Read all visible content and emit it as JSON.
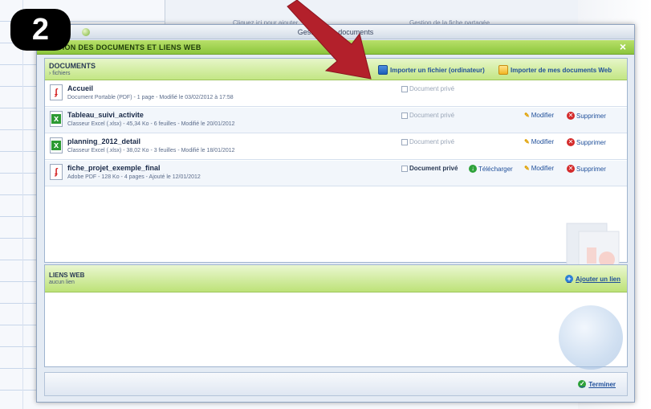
{
  "step_badge": "2",
  "background": {
    "behind_text_left": "Cliquez ici pour ajouter",
    "behind_text_right": "Gestion de la fiche partagée"
  },
  "window": {
    "title": "Gestion des documents",
    "header": "GESTION DES DOCUMENTS ET LIENS WEB",
    "close_label": "×"
  },
  "documents": {
    "title": "DOCUMENTS",
    "subtitle": "› fichiers",
    "upload_button": "Importer un fichier (ordinateur)",
    "import_button": "Importer de mes documents Web",
    "rows": [
      {
        "name": "Accueil",
        "meta": "Document Portable (PDF) - 1 page - Modifié le 03/02/2012 à 17:58",
        "icon": "pdf-icon",
        "private_label": "Document privé",
        "private_checked": false,
        "actions": []
      },
      {
        "name": "Tableau_suivi_activite",
        "meta": "Classeur Excel (.xlsx) - 45,34 Ko - 6 feuilles - Modifié le 20/01/2012",
        "icon": "excel-icon",
        "private_label": "Document privé",
        "private_checked": false,
        "actions": [
          "Modifier",
          "Supprimer"
        ]
      },
      {
        "name": "planning_2012_detail",
        "meta": "Classeur Excel (.xlsx) - 38,02 Ko - 3 feuilles - Modifié le 18/01/2012",
        "icon": "excel-icon",
        "private_label": "Document privé",
        "private_checked": false,
        "actions": [
          "Modifier",
          "Supprimer"
        ]
      },
      {
        "name": "fiche_projet_exemple_final",
        "meta": "Adobe PDF - 128 Ko - 4 pages - Ajouté le 12/01/2012",
        "icon": "pdf-icon",
        "private_label": "Document privé",
        "private_checked": true,
        "actions": [
          "Télécharger",
          "Modifier",
          "Supprimer"
        ]
      }
    ]
  },
  "links": {
    "title": "LIENS WEB",
    "subtitle": "aucun lien",
    "add_button": "Ajouter un lien"
  },
  "footer": {
    "close_button": "Terminer"
  },
  "colors": {
    "accent_green": "#8cc63c",
    "link_blue": "#1f4f9a",
    "arrow_red": "#b3202b",
    "badge": "#000000"
  }
}
